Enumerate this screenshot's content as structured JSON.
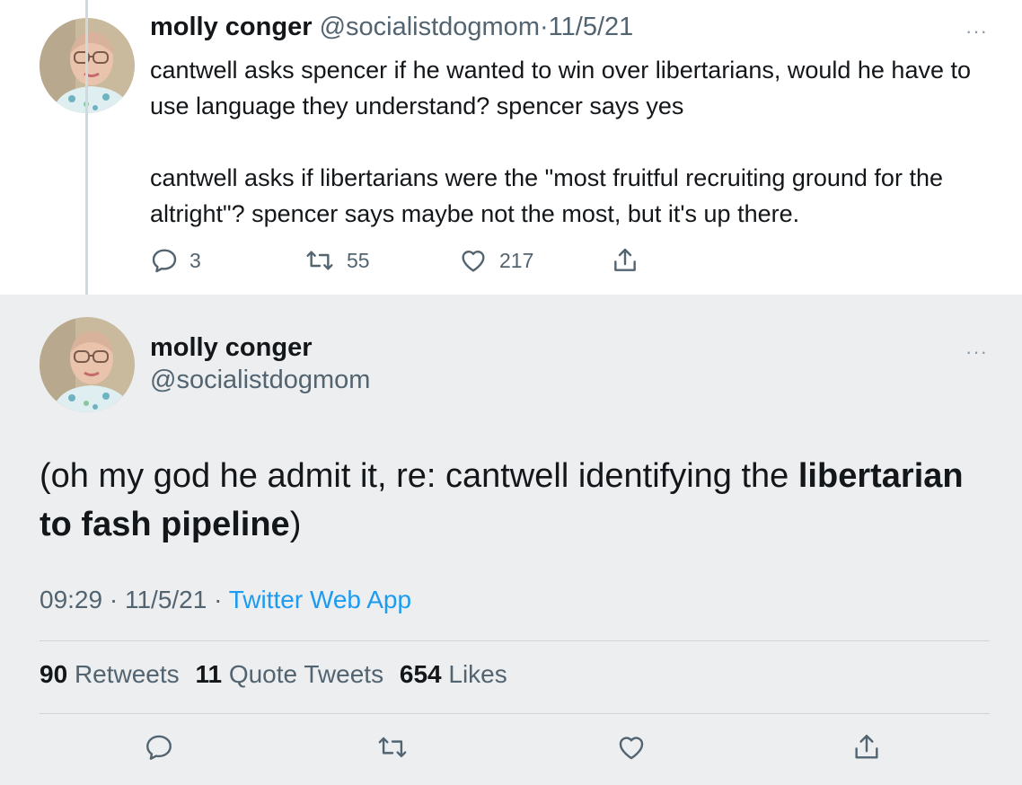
{
  "top_tweet": {
    "author_name": "molly conger",
    "handle": "@socialistdogmom",
    "separator": "·",
    "date": "11/5/21",
    "more": "···",
    "paragraphs": [
      "cantwell asks spencer if he wanted to win over libertarians, would he have to use language they understand? spencer says yes",
      "cantwell asks if libertarians were the \"most fruitful recruiting ground for the altright\"? spencer says maybe not the most, but it's up there."
    ],
    "actions": {
      "replies": "3",
      "retweets": "55",
      "likes": "217"
    }
  },
  "main_tweet": {
    "author_name": "molly conger",
    "handle": "@socialistdogmom",
    "more": "···",
    "text_before": "(oh my god he admit it, re: cantwell identifying the ",
    "text_bold": "libertarian to fash pipeline",
    "text_after": ")",
    "time": "09:29",
    "separator": "·",
    "date": "11/5/21",
    "source": "Twitter Web App",
    "stats": {
      "retweets_count": "90",
      "retweets_label": "Retweets",
      "quotes_count": "11",
      "quotes_label": "Quote Tweets",
      "likes_count": "654",
      "likes_label": "Likes"
    }
  },
  "icons": {
    "reply": "reply-icon",
    "retweet": "retweet-icon",
    "like": "heart-icon",
    "share": "share-icon",
    "more": "more-icon"
  },
  "colors": {
    "link": "#1d9bf0",
    "secondary_text": "#536471",
    "main_background": "#eceef0"
  }
}
